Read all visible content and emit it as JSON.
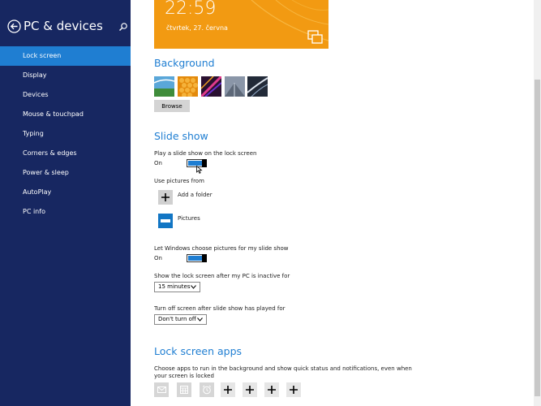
{
  "sidebar": {
    "title": "PC & devices",
    "items": [
      {
        "label": "Lock screen",
        "active": true
      },
      {
        "label": "Display"
      },
      {
        "label": "Devices"
      },
      {
        "label": "Mouse & touchpad"
      },
      {
        "label": "Typing"
      },
      {
        "label": "Corners & edges"
      },
      {
        "label": "Power & sleep"
      },
      {
        "label": "AutoPlay"
      },
      {
        "label": "PC info"
      }
    ]
  },
  "preview": {
    "time": "22:59",
    "date": "čtvrtek, 27. června"
  },
  "background": {
    "title": "Background",
    "browse_label": "Browse"
  },
  "slideshow": {
    "title": "Slide show",
    "play_label": "Play a slide show on the lock screen",
    "play_state": "On",
    "use_pictures_label": "Use pictures from",
    "add_folder_label": "Add a folder",
    "pictures_label": "Pictures",
    "let_windows_label": "Let Windows choose pictures for my slide show",
    "let_windows_state": "On",
    "inactive_label": "Show the lock screen after my PC is inactive for",
    "inactive_value": "15 minutes",
    "turnoff_label": "Turn off screen after slide show has played for",
    "turnoff_value": "Don't turn off"
  },
  "lockapps": {
    "title": "Lock screen apps",
    "desc_line1": "Choose apps to run in the background and show quick status and notifications, even when",
    "desc_line2": "your screen is locked"
  },
  "colors": {
    "sidebar_bg": "#172761",
    "accent": "#1f7ed2",
    "preview_bg": "#f29a12"
  }
}
